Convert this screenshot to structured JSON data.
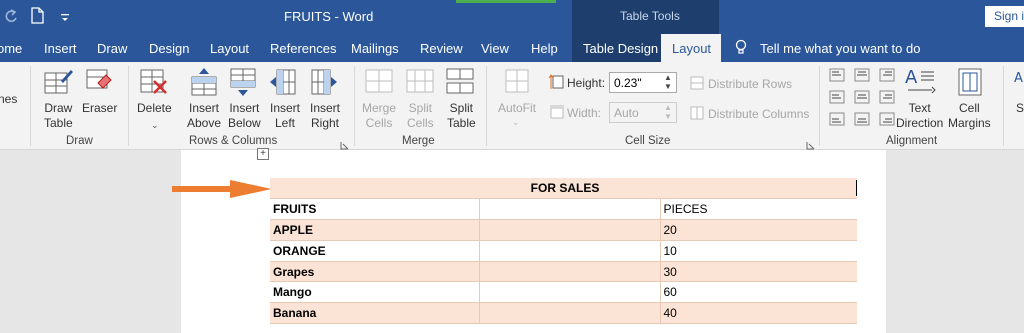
{
  "titlebar": {
    "doc_title": "FRUITS - Word",
    "signin": "Sign i",
    "tool_context": "Table Tools"
  },
  "tabs": [
    "ome",
    "Insert",
    "Draw",
    "Design",
    "Layout",
    "References",
    "Mailings",
    "Review",
    "View",
    "Help",
    "Table Design"
  ],
  "active_tab": "Layout",
  "tell_me": "Tell me what you want to do",
  "ribbon": {
    "left_clip": "nes",
    "draw_table": [
      "Draw",
      "Table"
    ],
    "eraser": "Eraser",
    "delete": "Delete",
    "insert_above": [
      "Insert",
      "Above"
    ],
    "insert_below": [
      "Insert",
      "Below"
    ],
    "insert_left": [
      "Insert",
      "Left"
    ],
    "insert_right": [
      "Insert",
      "Right"
    ],
    "merge_cells": [
      "Merge",
      "Cells"
    ],
    "split_cells": [
      "Split",
      "Cells"
    ],
    "split_table": [
      "Split",
      "Table"
    ],
    "autofit": "AutoFit",
    "height_label": "Height:",
    "height_value": "0.23\"",
    "width_label": "Width:",
    "width_value": "Auto",
    "distribute_rows": "Distribute Rows",
    "distribute_columns": "Distribute Columns",
    "text_direction": [
      "Text",
      "Direction"
    ],
    "cell_margins": [
      "Cell",
      "Margins"
    ],
    "right_clip": "S",
    "groups": {
      "draw": "Draw",
      "rows_columns": "Rows & Columns",
      "merge": "Merge",
      "cell_size": "Cell Size",
      "alignment": "Alignment"
    }
  },
  "table": {
    "header": "FOR SALES",
    "rows": [
      [
        "FRUITS",
        "",
        "PIECES"
      ],
      [
        "APPLE",
        "",
        "20"
      ],
      [
        "ORANGE",
        "",
        "10"
      ],
      [
        "Grapes",
        "",
        "30"
      ],
      [
        "Mango",
        "",
        "60"
      ],
      [
        "Banana",
        "",
        "40"
      ]
    ]
  },
  "colors": {
    "word_blue": "#2b579a",
    "table_tools": "#1e3f6e",
    "peach": "#fbe4d5",
    "arrow": "#ed7d31"
  }
}
